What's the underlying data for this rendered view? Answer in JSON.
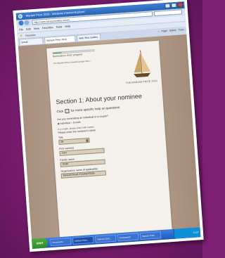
{
  "browser": {
    "window_title": "Mariam Prize 2010 - Windows Internet Explorer",
    "url": "http://www.surveymonkey.com/s/...",
    "menu": [
      "File",
      "Edit",
      "View",
      "Favorites",
      "Tools",
      "Help"
    ],
    "favorites_label": "Favorites",
    "tabs": [
      "Gmail",
      "Mariam Prize 2010",
      "Web Slice Gallery"
    ],
    "tool_labels": [
      "Page",
      "Safety",
      "Tools"
    ]
  },
  "form": {
    "progress_percent": 20,
    "progress_label": "Nominations 2010: progress",
    "intro_text": "The Mariam Prize rewards people who...",
    "logo_text": "THE MARIAM PRIZE 2010",
    "section_title": "Section 1: About your nominee",
    "help_text_before": "Click",
    "help_text_after": "for more specific help on questions.",
    "question_nominee_type": "Are you nominating an individual or a couple?",
    "option_individual": "Individual",
    "option_couple": "Couple",
    "sub_note": "If a couple, please enter both names",
    "question_details": "Please enter the nominee's name",
    "title_label": "Title",
    "title_value": "Mr",
    "first_name_label": "First name(s)",
    "first_name_value": "John",
    "family_name_label": "Family name",
    "family_name_value": "Smith",
    "org_label": "Organisation name (if applicable)",
    "org_value": "MACARTHUR FOUNDATION"
  },
  "taskbar": {
    "start_label": "start",
    "items": [
      "Documents",
      "Mariam Prize...",
      "Mariam 2010...",
      "Document3",
      "Mariam Prize"
    ],
    "clock": "11:07"
  },
  "colors": {
    "background": "#7d1f73",
    "progress_fill": "#3aa64c",
    "taskbar": "#2a63b4"
  }
}
